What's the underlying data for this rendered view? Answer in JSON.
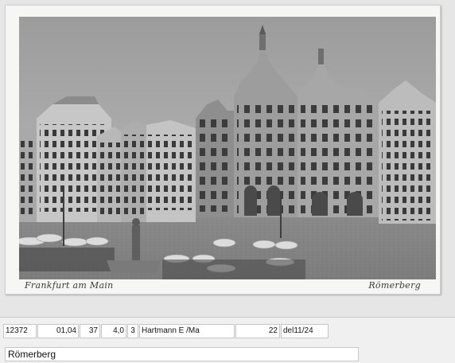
{
  "postcard": {
    "caption_left": "Frankfurt am Main",
    "caption_right": "Römerberg"
  },
  "record": {
    "id": "12372",
    "date": "01,04",
    "num1": "37",
    "num2": "4,0",
    "num3": "3",
    "publisher": "Hartmann E /Ma",
    "num4": "22",
    "deleted": "del11/24",
    "title": "Römerberg"
  }
}
